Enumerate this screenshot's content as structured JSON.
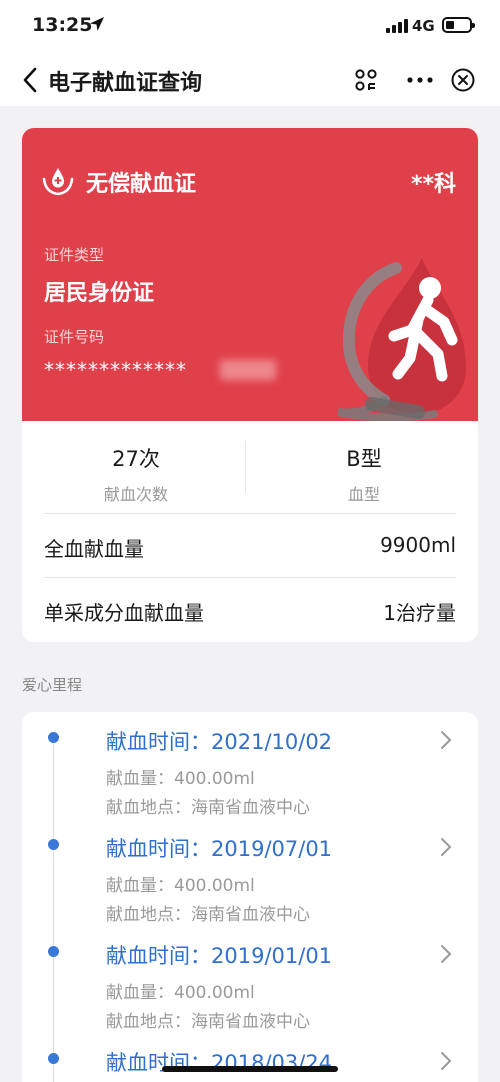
{
  "status_bar": {
    "time": "13:25",
    "network": "4G",
    "icons": [
      "location-arrow-icon",
      "signal-icon",
      "battery-icon"
    ]
  },
  "nav": {
    "title": "电子献血证查询",
    "icons": [
      "back-chevron-icon",
      "scan-icon",
      "more-icon",
      "close-icon"
    ]
  },
  "card": {
    "title": "无偿献血证",
    "holder_name": "**科",
    "id_type_label": "证件类型",
    "id_type": "居民身份证",
    "id_number_label": "证件号码",
    "id_number": "*************",
    "background_color": "#e0404a"
  },
  "stats": {
    "count_value": "27次",
    "count_label": "献血次数",
    "blood_type_value": "B型",
    "blood_type_label": "血型",
    "whole_blood_label": "全血献血量",
    "whole_blood_value": "9900ml",
    "apheresis_label": "单采成分血献血量",
    "apheresis_value": "1治疗量"
  },
  "timeline": {
    "section_title": "爱心里程",
    "accent_color": "#2f6fcf",
    "items": [
      {
        "date": "献血时间：2021/10/02",
        "amount": "献血量：400.00ml",
        "place": "献血地点：海南省血液中心"
      },
      {
        "date": "献血时间：2019/07/01",
        "amount": "献血量：400.00ml",
        "place": "献血地点：海南省血液中心"
      },
      {
        "date": "献血时间：2019/01/01",
        "amount": "献血量：400.00ml",
        "place": "献血地点：海南省血液中心"
      },
      {
        "date": "献血时间：2018/03/24"
      }
    ]
  }
}
